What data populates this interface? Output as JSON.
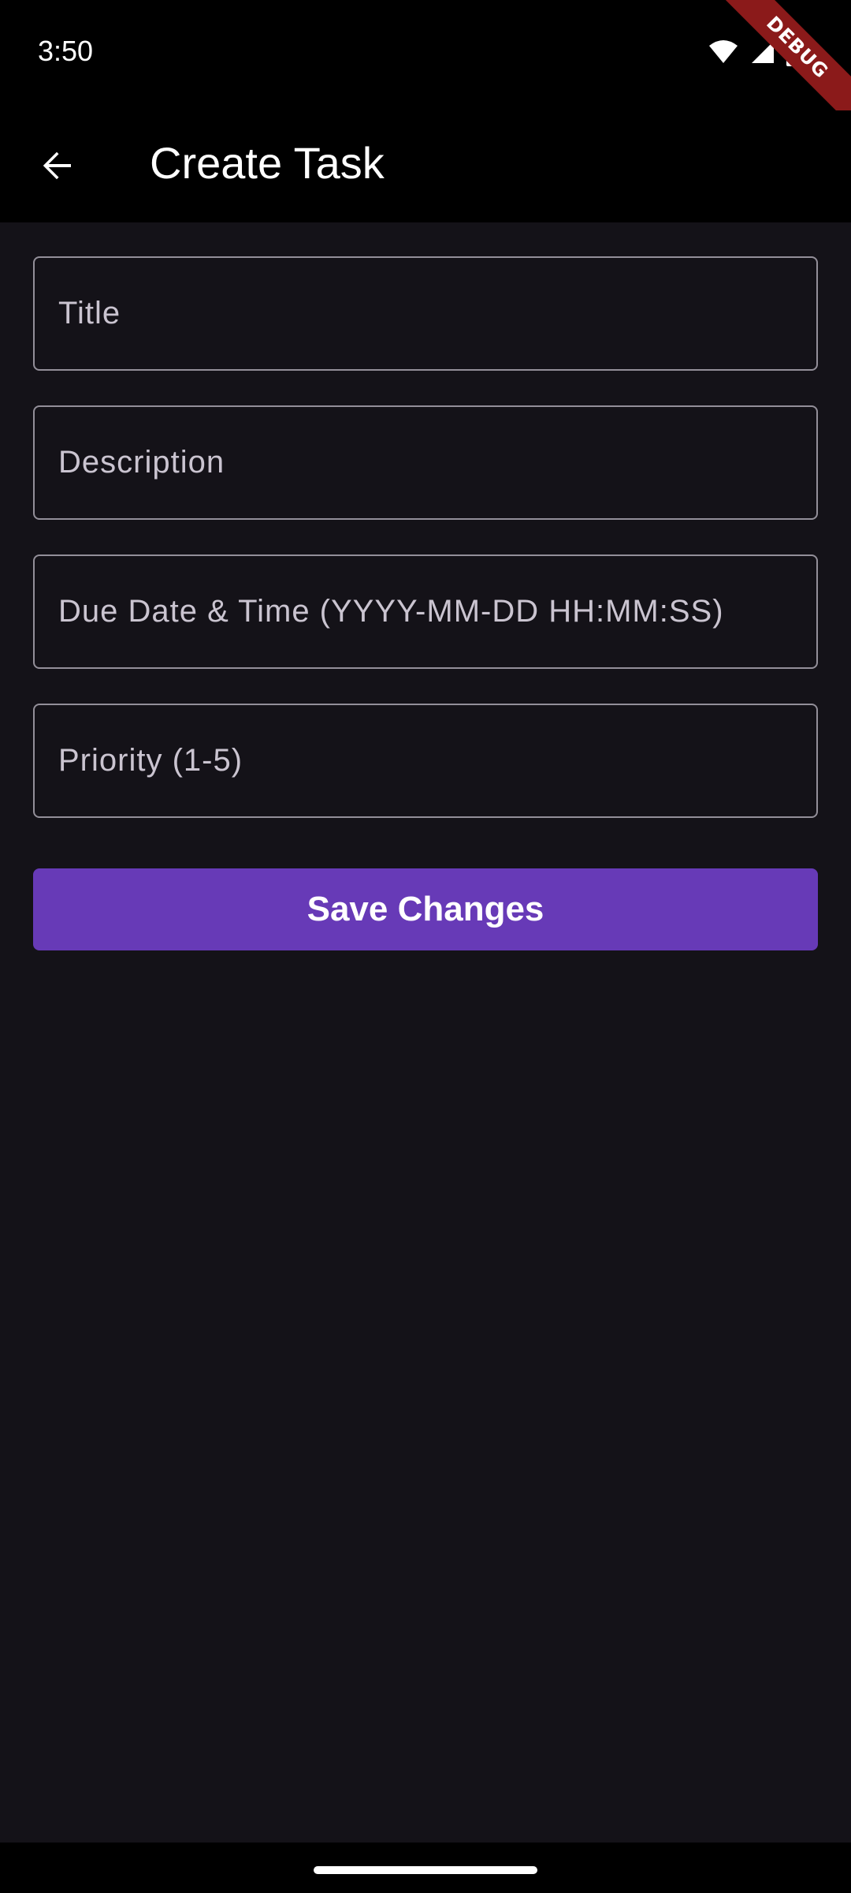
{
  "status_bar": {
    "time": "3:50",
    "icons": [
      "wifi-icon",
      "signal-icon",
      "battery-icon"
    ]
  },
  "debug_banner": {
    "label": "DEBUG",
    "color": "#8b1a1a"
  },
  "app_bar": {
    "title": "Create Task",
    "back_icon": "arrow-back-icon"
  },
  "form": {
    "title_field": {
      "value": "",
      "placeholder": "Title"
    },
    "description_field": {
      "value": "",
      "placeholder": "Description"
    },
    "due_date_field": {
      "value": "",
      "placeholder": "Due Date & Time (YYYY-MM-DD HH:MM:SS)"
    },
    "priority_field": {
      "value": "",
      "placeholder": "Priority (1-5)"
    }
  },
  "actions": {
    "save_label": "Save Changes"
  },
  "colors": {
    "background": "#141218",
    "app_bar": "#000000",
    "accent": "#673ab7",
    "field_border": "#938f99"
  }
}
